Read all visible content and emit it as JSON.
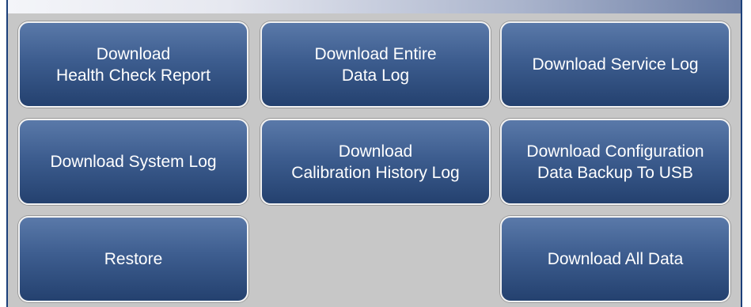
{
  "buttons": {
    "health_check": "Download\nHealth Check Report",
    "entire_data_log": "Download Entire\nData Log",
    "service_log": "Download Service Log",
    "system_log": "Download System Log",
    "calibration_history": "Download\nCalibration History Log",
    "config_backup": "Download Configuration\nData Backup To USB",
    "restore": "Restore",
    "all_data": "Download All Data"
  },
  "colors": {
    "button_top": "#5a79a9",
    "button_bottom": "#24416f",
    "panel_background": "#c7c7c7",
    "border_accent": "#1b3f7a"
  }
}
